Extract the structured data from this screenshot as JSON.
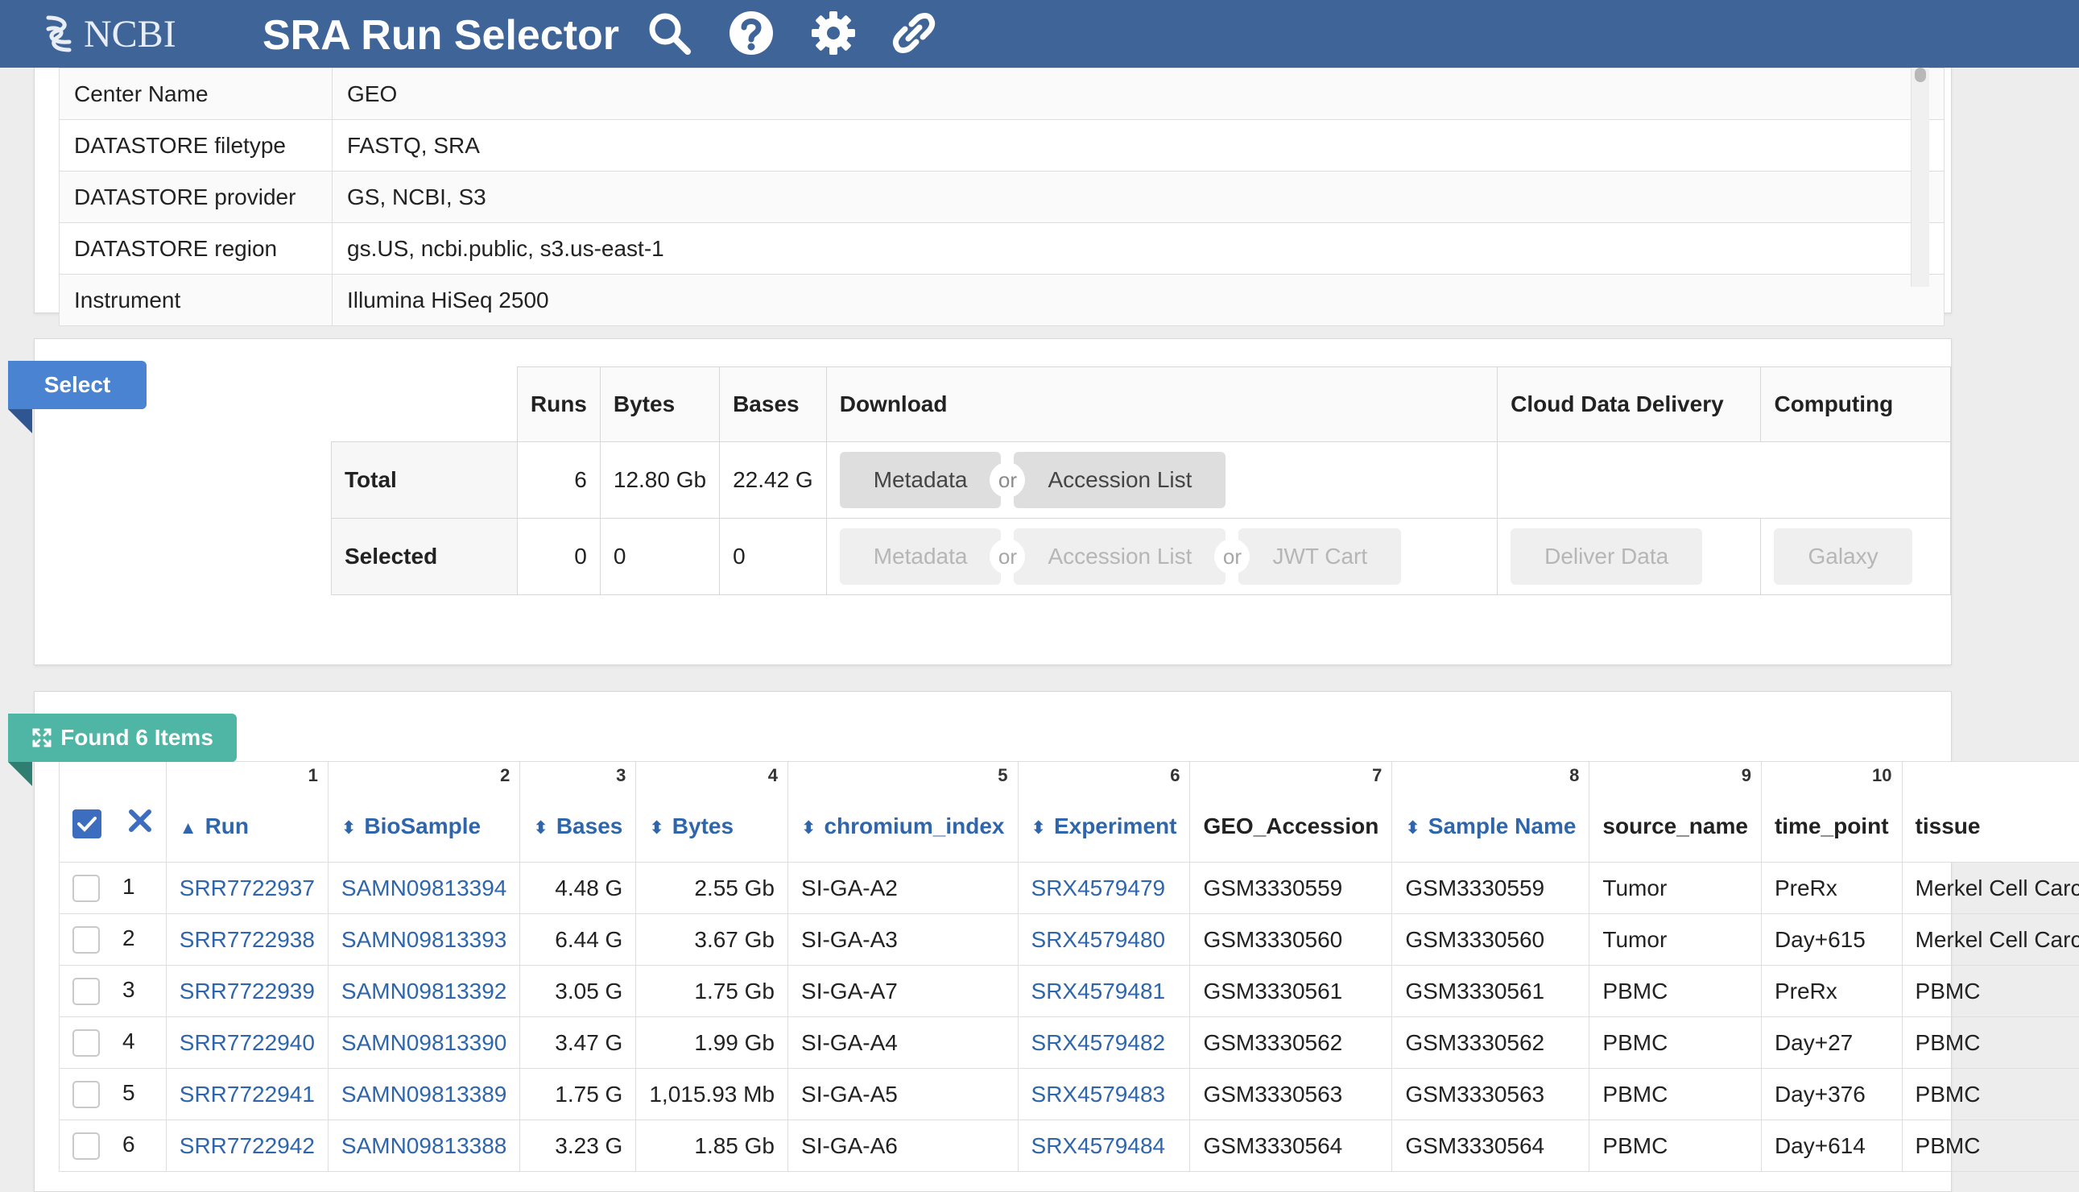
{
  "header": {
    "logo": "NCBI",
    "title": "SRA Run Selector",
    "icons": [
      "search-icon",
      "help-icon",
      "settings-icon",
      "link-icon"
    ]
  },
  "metadata": {
    "rows": [
      {
        "key": "Center Name",
        "value": "GEO"
      },
      {
        "key": "DATASTORE filetype",
        "value": "FASTQ, SRA"
      },
      {
        "key": "DATASTORE provider",
        "value": "GS, NCBI, S3"
      },
      {
        "key": "DATASTORE region",
        "value": "gs.US, ncbi.public, s3.us-east-1"
      },
      {
        "key": "Instrument",
        "value": "Illumina HiSeq 2500"
      }
    ]
  },
  "select": {
    "ribbon": "Select",
    "headers": {
      "runs": "Runs",
      "bytes": "Bytes",
      "bases": "Bases",
      "download": "Download",
      "cloud": "Cloud Data Delivery",
      "computing": "Computing"
    },
    "total": {
      "label": "Total",
      "runs": "6",
      "bytes": "12.80 Gb",
      "bases": "22.42 G"
    },
    "selected": {
      "label": "Selected",
      "runs": "0",
      "bytes": "0",
      "bases": "0"
    },
    "buttons": {
      "metadata": "Metadata",
      "or": "or",
      "accession_list": "Accession List",
      "jwt_cart": "JWT Cart",
      "deliver_data": "Deliver Data",
      "galaxy": "Galaxy"
    }
  },
  "found": {
    "ribbon": "Found 6 Items",
    "columns": [
      {
        "num": "1",
        "label": "Run"
      },
      {
        "num": "2",
        "label": "BioSample"
      },
      {
        "num": "3",
        "label": "Bases"
      },
      {
        "num": "4",
        "label": "Bytes"
      },
      {
        "num": "5",
        "label": "chromium_index"
      },
      {
        "num": "6",
        "label": "Experiment"
      },
      {
        "num": "7",
        "label": "GEO_Accession"
      },
      {
        "num": "8",
        "label": "Sample Name"
      },
      {
        "num": "9",
        "label": "source_name"
      },
      {
        "num": "10",
        "label": "time_point"
      },
      {
        "num": "",
        "label": "tissue"
      }
    ],
    "rows": [
      {
        "idx": "1",
        "run": "SRR7722937",
        "biosample": "SAMN09813394",
        "bases": "4.48 G",
        "bytes": "2.55 Gb",
        "chromium_index": "SI-GA-A2",
        "experiment": "SRX4579479",
        "geo": "GSM3330559",
        "sample_name": "GSM3330559",
        "source": "Tumor",
        "time_point": "PreRx",
        "tissue": "Merkel Cell Carc"
      },
      {
        "idx": "2",
        "run": "SRR7722938",
        "biosample": "SAMN09813393",
        "bases": "6.44 G",
        "bytes": "3.67 Gb",
        "chromium_index": "SI-GA-A3",
        "experiment": "SRX4579480",
        "geo": "GSM3330560",
        "sample_name": "GSM3330560",
        "source": "Tumor",
        "time_point": "Day+615",
        "tissue": "Merkel Cell Carc"
      },
      {
        "idx": "3",
        "run": "SRR7722939",
        "biosample": "SAMN09813392",
        "bases": "3.05 G",
        "bytes": "1.75 Gb",
        "chromium_index": "SI-GA-A7",
        "experiment": "SRX4579481",
        "geo": "GSM3330561",
        "sample_name": "GSM3330561",
        "source": "PBMC",
        "time_point": "PreRx",
        "tissue": "PBMC"
      },
      {
        "idx": "4",
        "run": "SRR7722940",
        "biosample": "SAMN09813390",
        "bases": "3.47 G",
        "bytes": "1.99 Gb",
        "chromium_index": "SI-GA-A4",
        "experiment": "SRX4579482",
        "geo": "GSM3330562",
        "sample_name": "GSM3330562",
        "source": "PBMC",
        "time_point": "Day+27",
        "tissue": "PBMC"
      },
      {
        "idx": "5",
        "run": "SRR7722941",
        "biosample": "SAMN09813389",
        "bases": "1.75 G",
        "bytes": "1,015.93 Mb",
        "chromium_index": "SI-GA-A5",
        "experiment": "SRX4579483",
        "geo": "GSM3330563",
        "sample_name": "GSM3330563",
        "source": "PBMC",
        "time_point": "Day+376",
        "tissue": "PBMC"
      },
      {
        "idx": "6",
        "run": "SRR7722942",
        "biosample": "SAMN09813388",
        "bases": "3.23 G",
        "bytes": "1.85 Gb",
        "chromium_index": "SI-GA-A6",
        "experiment": "SRX4579484",
        "geo": "GSM3330564",
        "sample_name": "GSM3330564",
        "source": "PBMC",
        "time_point": "Day+614",
        "tissue": "PBMC"
      }
    ]
  }
}
